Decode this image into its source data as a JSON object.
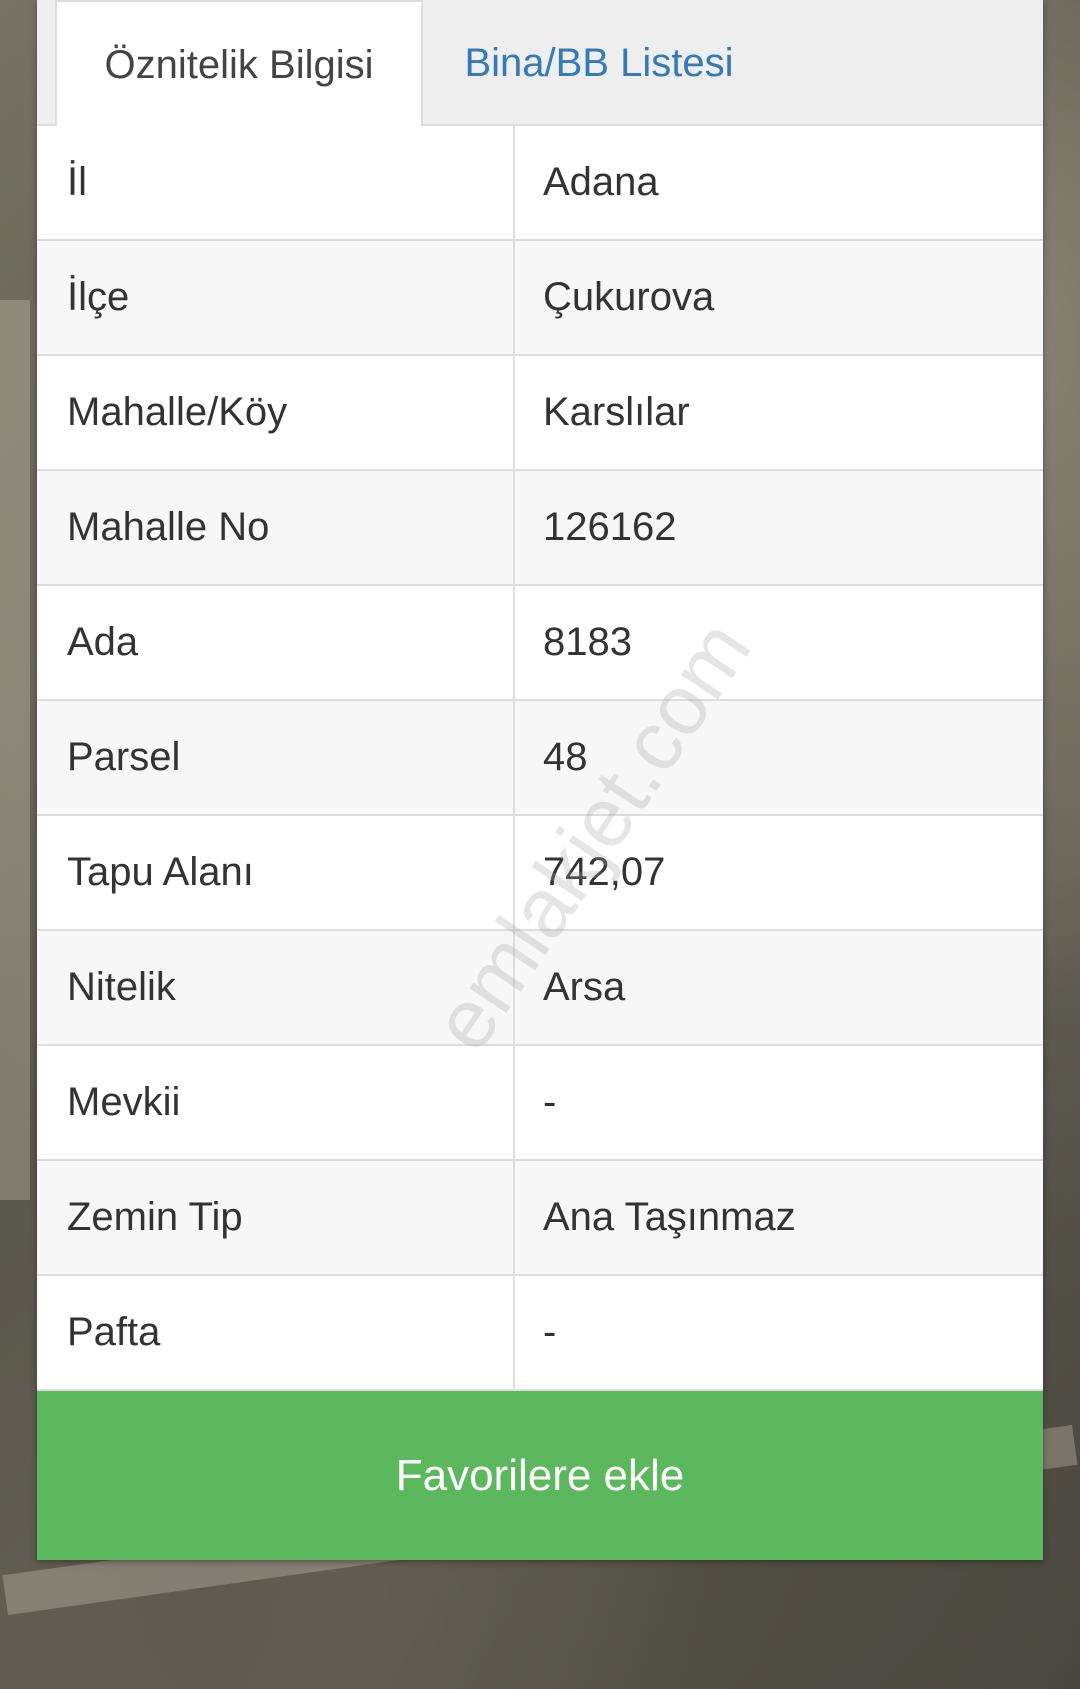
{
  "tabs": [
    {
      "label": "Öznitelik Bilgisi",
      "active": true
    },
    {
      "label": "Bina/BB Listesi",
      "active": false
    }
  ],
  "rows": [
    {
      "label": "İl",
      "value": "Adana"
    },
    {
      "label": "İlçe",
      "value": "Çukurova"
    },
    {
      "label": "Mahalle/Köy",
      "value": "Karslılar"
    },
    {
      "label": "Mahalle No",
      "value": "126162"
    },
    {
      "label": "Ada",
      "value": "8183"
    },
    {
      "label": "Parsel",
      "value": "48"
    },
    {
      "label": "Tapu Alanı",
      "value": "742,07"
    },
    {
      "label": "Nitelik",
      "value": "Arsa"
    },
    {
      "label": "Mevkii",
      "value": "-"
    },
    {
      "label": "Zemin Tip",
      "value": "Ana Taşınmaz"
    },
    {
      "label": "Pafta",
      "value": "-"
    }
  ],
  "favorite_button": {
    "label": "Favorilere ekle"
  },
  "watermark": "emlakjet.com",
  "colors": {
    "button_green": "#5cb85c",
    "link_blue": "#337ab7",
    "border": "#dddddd"
  }
}
